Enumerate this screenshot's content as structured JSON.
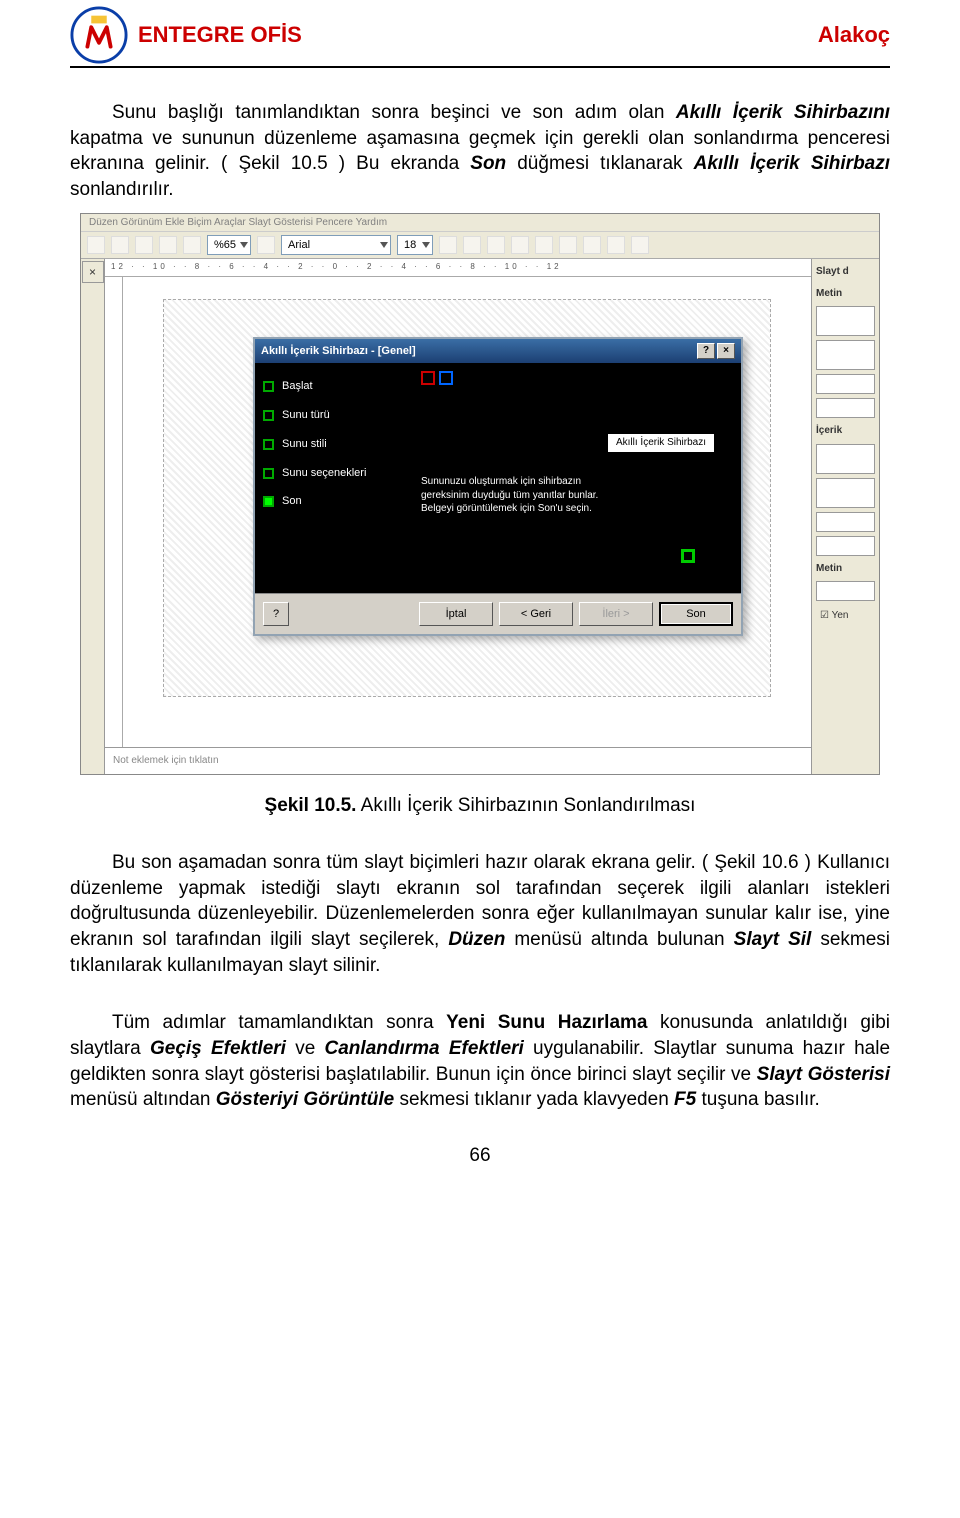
{
  "header": {
    "title": "ENTEGRE OFİS",
    "author": "Alakoç"
  },
  "para1_pre": "Sunu başlığı tanımlandıktan sonra beşinci ve son adım olan ",
  "para1_bold_i_1": "Akıllı İçerik Sihirbazını",
  "para1_mid": " kapatma ve sununun düzenleme aşamasına geçmek için gerekli olan sonlandırma penceresi ekranına gelinir. ( Şekil 10.5 ) Bu ekranda ",
  "para1_bold_i_2": "Son",
  "para1_mid2": " düğmesi tıklanarak ",
  "para1_bold_i_3": "Akıllı İçerik Sihirbazı",
  "para1_end": " sonlandırılır.",
  "figure": {
    "menubar": "Düzen  Görünüm  Ekle  Biçim  Araçlar  Slayt Gösterisi  Pencere  Yardım",
    "zoom": "%65",
    "font": "Arial",
    "fontsize": "18",
    "ruler": "12 · · 10 · · 8 · · 6 · · 4 · · 2 · · 0 · · 2 · · 4 · · 6 · · 8 · · 10 · · 12",
    "panel_label_1": "Slayt d",
    "panel_label_2": "Metin",
    "panel_label_3": "İçerik",
    "panel_label_4": "Metin",
    "yen": "Yen",
    "note": "Not eklemek için tıklatın",
    "wizard": {
      "title": "Akıllı İçerik Sihirbazı - [Genel]",
      "help": "?",
      "close": "×",
      "steps": {
        "s1": "Başlat",
        "s2": "Sunu türü",
        "s3": "Sunu stili",
        "s4": "Sunu seçenekleri",
        "s5": "Son"
      },
      "slab": "Akıllı İçerik Sihirbazı",
      "desc1": "Sununuzu oluşturmak için sihirbazın",
      "desc2": "gereksinim duyduğu tüm yanıtlar bunlar.",
      "desc3": "Belgeyi görüntülemek için Son'u seçin.",
      "buttons": {
        "help": "?",
        "cancel": "İptal",
        "back": "< Geri",
        "next": "İleri >",
        "finish": "Son"
      }
    }
  },
  "caption_bold": "Şekil 10.5.",
  "caption_rest": " Akıllı İçerik Sihirbazının Sonlandırılması",
  "para2_pre": "Bu son aşamadan sonra tüm slayt biçimleri hazır olarak ekrana gelir. ( Şekil 10.6 ) Kullanıcı düzenleme yapmak istediği slaytı ekranın sol tarafından seçerek ilgili alanları istekleri doğrultusunda düzenleyebilir. Düzenlemelerden sonra eğer kullanılmayan sunular kalır ise, yine ekranın sol tarafından ilgili slayt seçilerek, ",
  "para2_bold_i_1": "Düzen",
  "para2_mid1": " menüsü altında bulunan ",
  "para2_bold_i_2": "Slayt Sil",
  "para2_end": " sekmesi tıklanılarak kullanılmayan slayt silinir.",
  "para3_pre": "Tüm adımlar tamamlandıktan sonra ",
  "para3_bold_1": "Yeni Sunu Hazırlama",
  "para3_mid1": " konusunda anlatıldığı gibi slaytlara ",
  "para3_bold_i_1": "Geçiş Efektleri",
  "para3_mid2": " ve ",
  "para3_bold_i_2": "Canlandırma Efektleri",
  "para3_mid3": " uygulanabilir. Slaytlar sunuma hazır hale geldikten sonra slayt gösterisi başlatılabilir. Bunun için önce birinci slayt seçilir ve ",
  "para3_bold_i_3": "Slayt Gösterisi",
  "para3_mid4": " menüsü altından ",
  "para3_bold_i_4": "Gösteriyi Görüntüle",
  "para3_mid5": " sekmesi tıklanır yada klavyeden ",
  "para3_bold_i_5": "F5",
  "para3_end": " tuşuna basılır.",
  "page_num": "66"
}
